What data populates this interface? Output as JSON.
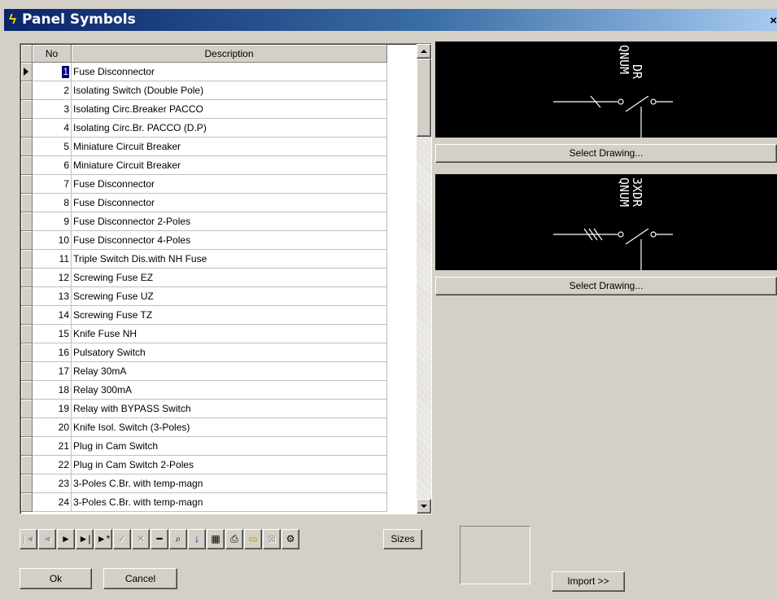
{
  "window": {
    "title": "Panel Symbols",
    "close_label": "×"
  },
  "table": {
    "headers": {
      "no": "No",
      "description": "Description"
    },
    "rows": [
      {
        "no": "1",
        "desc": "Fuse Disconnector"
      },
      {
        "no": "2",
        "desc": "Isolating Switch (Double Pole)"
      },
      {
        "no": "3",
        "desc": "Isolating Circ.Breaker PACCO"
      },
      {
        "no": "4",
        "desc": "Isolating Circ.Br. PACCO (D.P)"
      },
      {
        "no": "5",
        "desc": "Miniature Circuit Breaker"
      },
      {
        "no": "6",
        "desc": "Miniature Circuit Breaker"
      },
      {
        "no": "7",
        "desc": "Fuse Disconnector"
      },
      {
        "no": "8",
        "desc": "Fuse Disconnector"
      },
      {
        "no": "9",
        "desc": "Fuse Disconnector 2-Poles"
      },
      {
        "no": "10",
        "desc": "Fuse Disconnector 4-Poles"
      },
      {
        "no": "11",
        "desc": "Triple Switch Dis.with NH Fuse"
      },
      {
        "no": "12",
        "desc": "Screwing Fuse EZ"
      },
      {
        "no": "13",
        "desc": "Screwing Fuse UZ"
      },
      {
        "no": "14",
        "desc": "Screwing Fuse TZ"
      },
      {
        "no": "15",
        "desc": "Knife Fuse NH"
      },
      {
        "no": "16",
        "desc": "Pulsatory Switch"
      },
      {
        "no": "17",
        "desc": "Relay 30mA"
      },
      {
        "no": "18",
        "desc": "Relay 300mA"
      },
      {
        "no": "19",
        "desc": "Relay with BYPASS Switch"
      },
      {
        "no": "20",
        "desc": "Knife Isol. Switch (3-Poles)"
      },
      {
        "no": "21",
        "desc": "Plug in Cam Switch"
      },
      {
        "no": "22",
        "desc": "Plug in Cam Switch 2-Poles"
      },
      {
        "no": "23",
        "desc": "3-Poles C.Br. with temp-magn"
      },
      {
        "no": "24",
        "desc": "3-Poles C.Br. with temp-magn"
      }
    ],
    "current_row": 0
  },
  "drawings": [
    {
      "label_top": "QNUM",
      "label_bottom": "DR",
      "select_label": "Select Drawing..."
    },
    {
      "label_top": "QNUM",
      "label_bottom": "3XDR",
      "select_label": "Select Drawing..."
    }
  ],
  "toolbar": {
    "first_icon": "first-record-icon",
    "prior_icon": "prior-record-icon",
    "next_icon": "next-record-icon",
    "last_icon": "last-record-icon",
    "insert_icon": "insert-record-icon",
    "post_icon": "post-check-icon",
    "cancel_edit_icon": "cancel-edit-icon",
    "delete_icon": "delete-record-icon",
    "find_icon": "binoculars-icon",
    "sort_icon": "sort-az-icon",
    "table_icon": "table-edit-icon",
    "print_icon": "printer-icon",
    "open_icon": "folder-open-icon",
    "close_icon": "close-window-icon",
    "dbf_icon": "dbf-icon",
    "sizes_label": "Sizes"
  },
  "buttons": {
    "ok": "Ok",
    "cancel": "Cancel",
    "import": "Import >>"
  },
  "colors": {
    "title_start": "#0a246a",
    "title_end": "#a6caf0",
    "face": "#d4d0c8",
    "preview_bg": "#000000",
    "selection": "#000080"
  }
}
